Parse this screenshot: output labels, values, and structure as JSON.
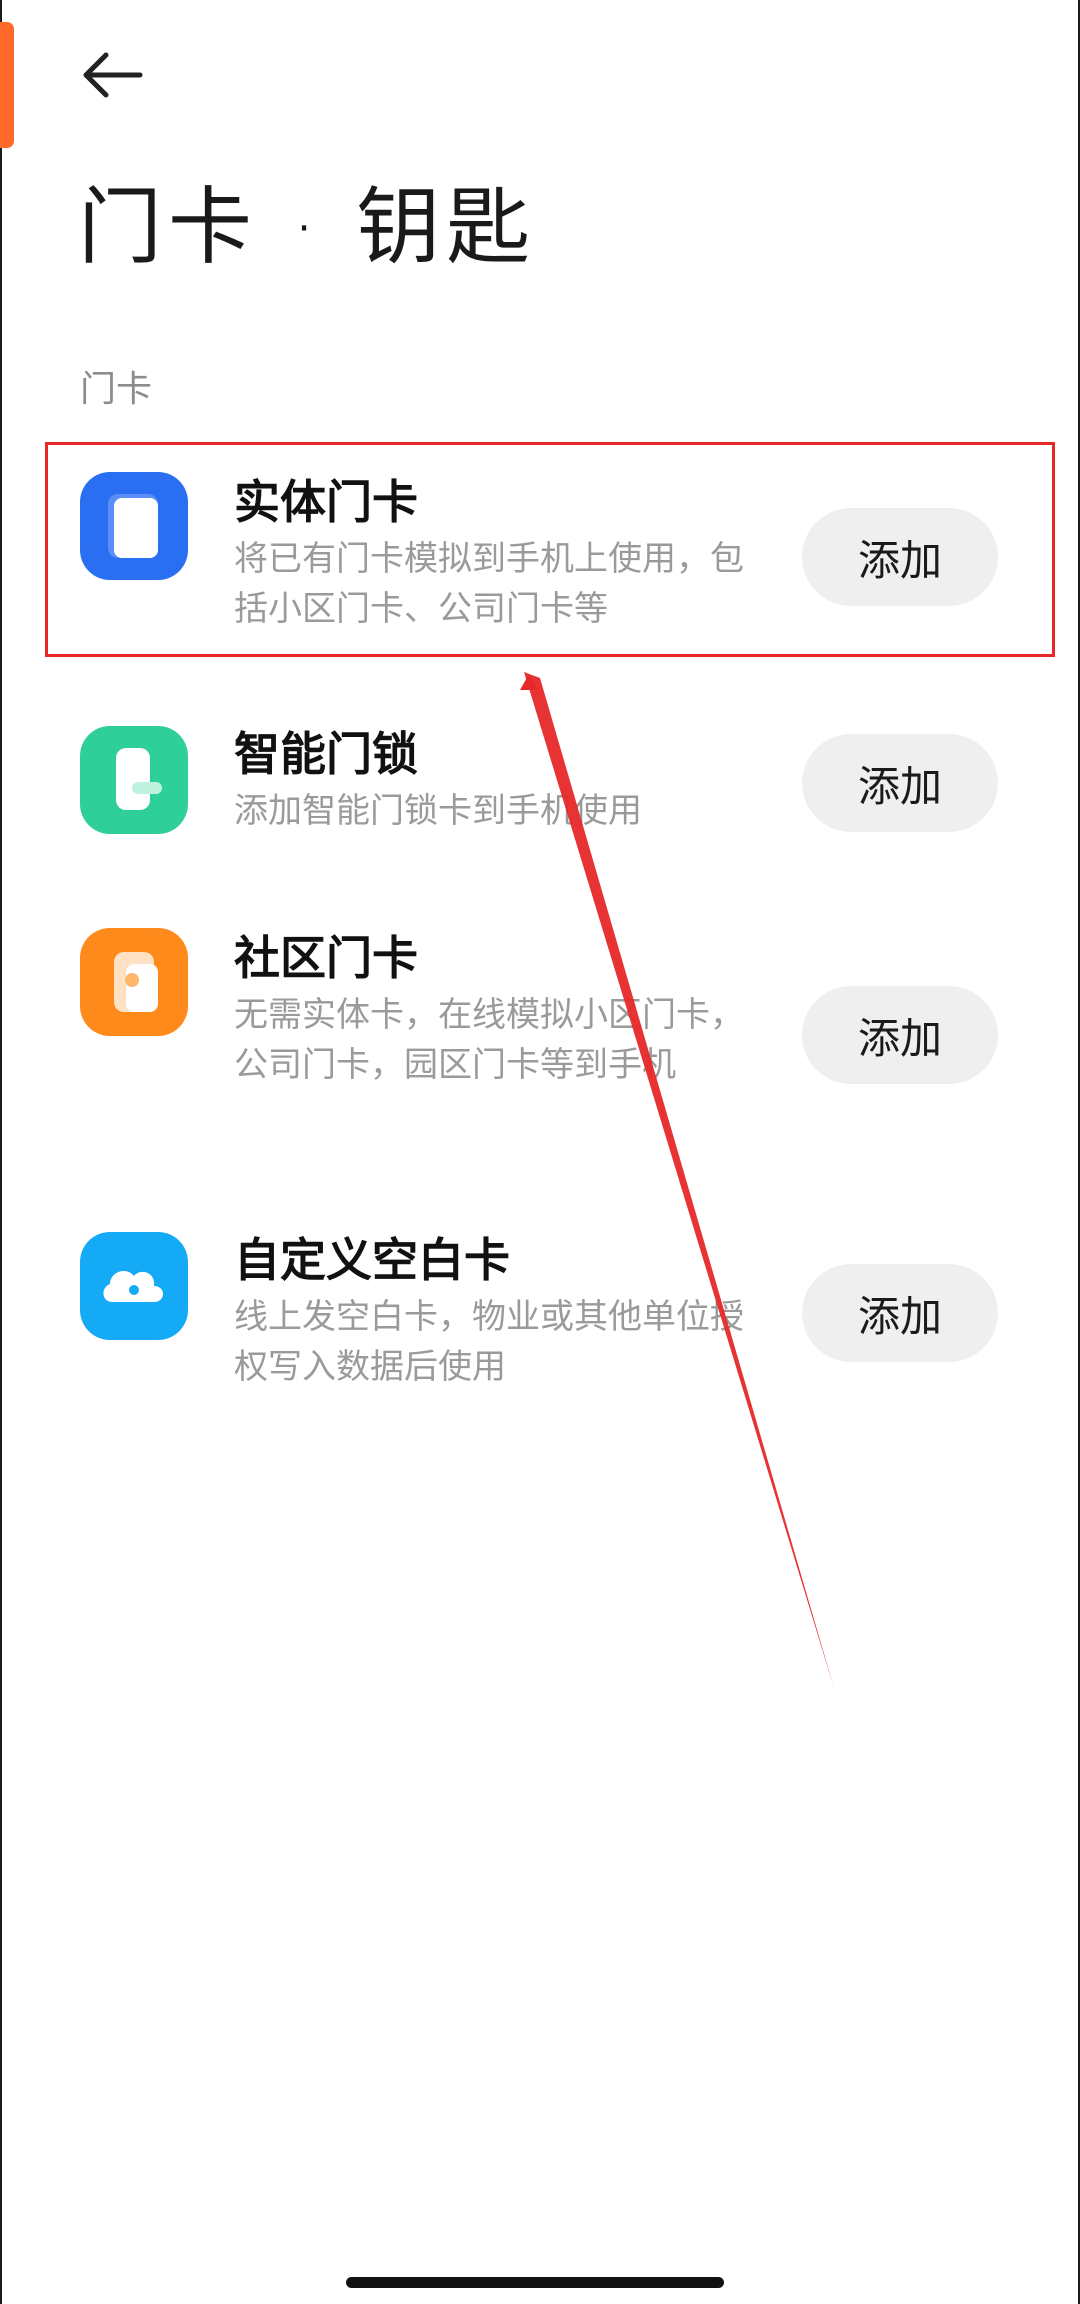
{
  "header": {
    "back_icon": "arrow-left-icon",
    "title": "门卡 · 钥匙"
  },
  "section": {
    "label": "门卡"
  },
  "items": [
    {
      "title": "实体门卡",
      "desc": "将已有门卡模拟到手机上使用，包括小区门卡、公司门卡等",
      "button": "添加",
      "icon": "card-icon",
      "color": "#2a6ef2"
    },
    {
      "title": "智能门锁",
      "desc": "添加智能门锁卡到手机使用",
      "button": "添加",
      "icon": "smart-lock-icon",
      "color": "#2fcf99"
    },
    {
      "title": "社区门卡",
      "desc": "无需实体卡，在线模拟小区门卡，公司门卡，园区门卡等到手机",
      "button": "添加",
      "icon": "community-card-icon",
      "color": "#ff8a1c"
    },
    {
      "title": "自定义空白卡",
      "desc": "线上发空白卡，物业或其他单位授权写入数据后使用",
      "button": "添加",
      "icon": "cloud-icon",
      "color": "#14aaf5"
    }
  ],
  "annotation": {
    "color": "#e62828"
  }
}
